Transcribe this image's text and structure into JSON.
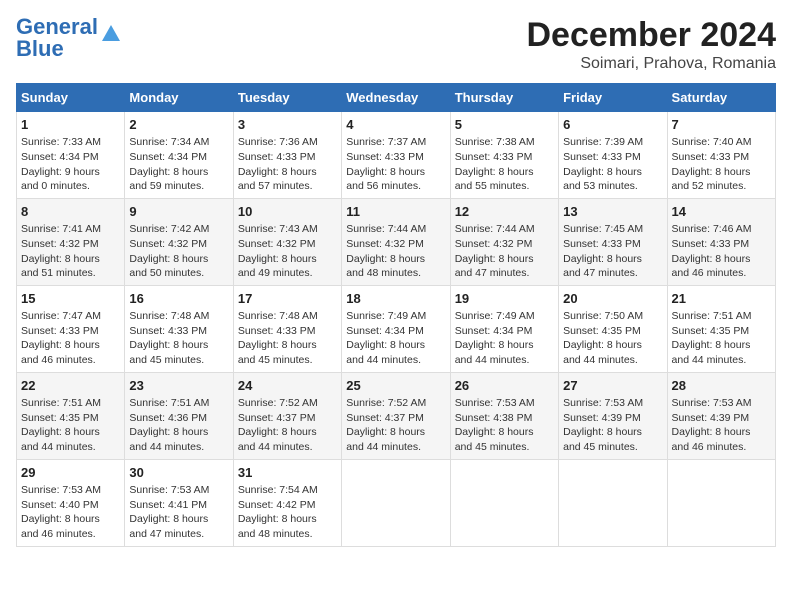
{
  "logo": {
    "line1": "General",
    "line2": "Blue"
  },
  "title": "December 2024",
  "subtitle": "Soimari, Prahova, Romania",
  "days_of_week": [
    "Sunday",
    "Monday",
    "Tuesday",
    "Wednesday",
    "Thursday",
    "Friday",
    "Saturday"
  ],
  "weeks": [
    [
      {
        "day": "1",
        "info": "Sunrise: 7:33 AM\nSunset: 4:34 PM\nDaylight: 9 hours\nand 0 minutes."
      },
      {
        "day": "2",
        "info": "Sunrise: 7:34 AM\nSunset: 4:34 PM\nDaylight: 8 hours\nand 59 minutes."
      },
      {
        "day": "3",
        "info": "Sunrise: 7:36 AM\nSunset: 4:33 PM\nDaylight: 8 hours\nand 57 minutes."
      },
      {
        "day": "4",
        "info": "Sunrise: 7:37 AM\nSunset: 4:33 PM\nDaylight: 8 hours\nand 56 minutes."
      },
      {
        "day": "5",
        "info": "Sunrise: 7:38 AM\nSunset: 4:33 PM\nDaylight: 8 hours\nand 55 minutes."
      },
      {
        "day": "6",
        "info": "Sunrise: 7:39 AM\nSunset: 4:33 PM\nDaylight: 8 hours\nand 53 minutes."
      },
      {
        "day": "7",
        "info": "Sunrise: 7:40 AM\nSunset: 4:33 PM\nDaylight: 8 hours\nand 52 minutes."
      }
    ],
    [
      {
        "day": "8",
        "info": "Sunrise: 7:41 AM\nSunset: 4:32 PM\nDaylight: 8 hours\nand 51 minutes."
      },
      {
        "day": "9",
        "info": "Sunrise: 7:42 AM\nSunset: 4:32 PM\nDaylight: 8 hours\nand 50 minutes."
      },
      {
        "day": "10",
        "info": "Sunrise: 7:43 AM\nSunset: 4:32 PM\nDaylight: 8 hours\nand 49 minutes."
      },
      {
        "day": "11",
        "info": "Sunrise: 7:44 AM\nSunset: 4:32 PM\nDaylight: 8 hours\nand 48 minutes."
      },
      {
        "day": "12",
        "info": "Sunrise: 7:44 AM\nSunset: 4:32 PM\nDaylight: 8 hours\nand 47 minutes."
      },
      {
        "day": "13",
        "info": "Sunrise: 7:45 AM\nSunset: 4:33 PM\nDaylight: 8 hours\nand 47 minutes."
      },
      {
        "day": "14",
        "info": "Sunrise: 7:46 AM\nSunset: 4:33 PM\nDaylight: 8 hours\nand 46 minutes."
      }
    ],
    [
      {
        "day": "15",
        "info": "Sunrise: 7:47 AM\nSunset: 4:33 PM\nDaylight: 8 hours\nand 46 minutes."
      },
      {
        "day": "16",
        "info": "Sunrise: 7:48 AM\nSunset: 4:33 PM\nDaylight: 8 hours\nand 45 minutes."
      },
      {
        "day": "17",
        "info": "Sunrise: 7:48 AM\nSunset: 4:33 PM\nDaylight: 8 hours\nand 45 minutes."
      },
      {
        "day": "18",
        "info": "Sunrise: 7:49 AM\nSunset: 4:34 PM\nDaylight: 8 hours\nand 44 minutes."
      },
      {
        "day": "19",
        "info": "Sunrise: 7:49 AM\nSunset: 4:34 PM\nDaylight: 8 hours\nand 44 minutes."
      },
      {
        "day": "20",
        "info": "Sunrise: 7:50 AM\nSunset: 4:35 PM\nDaylight: 8 hours\nand 44 minutes."
      },
      {
        "day": "21",
        "info": "Sunrise: 7:51 AM\nSunset: 4:35 PM\nDaylight: 8 hours\nand 44 minutes."
      }
    ],
    [
      {
        "day": "22",
        "info": "Sunrise: 7:51 AM\nSunset: 4:35 PM\nDaylight: 8 hours\nand 44 minutes."
      },
      {
        "day": "23",
        "info": "Sunrise: 7:51 AM\nSunset: 4:36 PM\nDaylight: 8 hours\nand 44 minutes."
      },
      {
        "day": "24",
        "info": "Sunrise: 7:52 AM\nSunset: 4:37 PM\nDaylight: 8 hours\nand 44 minutes."
      },
      {
        "day": "25",
        "info": "Sunrise: 7:52 AM\nSunset: 4:37 PM\nDaylight: 8 hours\nand 44 minutes."
      },
      {
        "day": "26",
        "info": "Sunrise: 7:53 AM\nSunset: 4:38 PM\nDaylight: 8 hours\nand 45 minutes."
      },
      {
        "day": "27",
        "info": "Sunrise: 7:53 AM\nSunset: 4:39 PM\nDaylight: 8 hours\nand 45 minutes."
      },
      {
        "day": "28",
        "info": "Sunrise: 7:53 AM\nSunset: 4:39 PM\nDaylight: 8 hours\nand 46 minutes."
      }
    ],
    [
      {
        "day": "29",
        "info": "Sunrise: 7:53 AM\nSunset: 4:40 PM\nDaylight: 8 hours\nand 46 minutes."
      },
      {
        "day": "30",
        "info": "Sunrise: 7:53 AM\nSunset: 4:41 PM\nDaylight: 8 hours\nand 47 minutes."
      },
      {
        "day": "31",
        "info": "Sunrise: 7:54 AM\nSunset: 4:42 PM\nDaylight: 8 hours\nand 48 minutes."
      },
      {
        "day": "",
        "info": ""
      },
      {
        "day": "",
        "info": ""
      },
      {
        "day": "",
        "info": ""
      },
      {
        "day": "",
        "info": ""
      }
    ]
  ]
}
